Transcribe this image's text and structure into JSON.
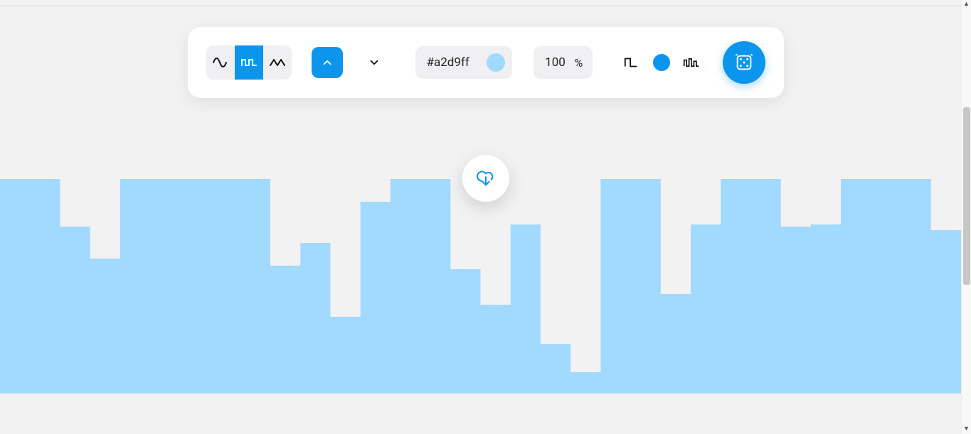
{
  "chart_data": {
    "type": "area",
    "title": "",
    "xlabel": "",
    "ylabel": "",
    "ylim": [
      0,
      302
    ],
    "note": "Heights are pixel heights from the 302px-tall preview strip; the app is a steps-wave pattern generator, not an axis-labeled chart.",
    "categories_note": "32 equal-width steps across 1351px canvas",
    "values": [
      302,
      302,
      235,
      190,
      302,
      302,
      302,
      302,
      302,
      180,
      212,
      108,
      270,
      302,
      302,
      175,
      125,
      238,
      70,
      30,
      302,
      302,
      140,
      238,
      302,
      302,
      235,
      238,
      302,
      302,
      302,
      230
    ]
  },
  "toolbar": {
    "wave_style": {
      "options": [
        "smooth",
        "steps",
        "linear"
      ],
      "selected": "steps"
    },
    "direction": {
      "selected": "up",
      "options": [
        "up",
        "down"
      ]
    },
    "color": {
      "hex": "#a2d9ff",
      "swatch_color": "#a2d9ff"
    },
    "opacity": {
      "value": "100",
      "suffix": "%"
    },
    "complexity_slider": {
      "min": 0,
      "max": 100,
      "value": 100
    },
    "accent_color": "#0b95ec"
  },
  "icons": {
    "smooth": "sine-wave",
    "steps": "square-wave",
    "linear": "sawtooth-wave",
    "up": "chevron-up",
    "down": "chevron-down",
    "freq_low": "square-pulse",
    "freq_high": "multi-pulse",
    "randomize": "dice",
    "download": "cloud-download"
  }
}
